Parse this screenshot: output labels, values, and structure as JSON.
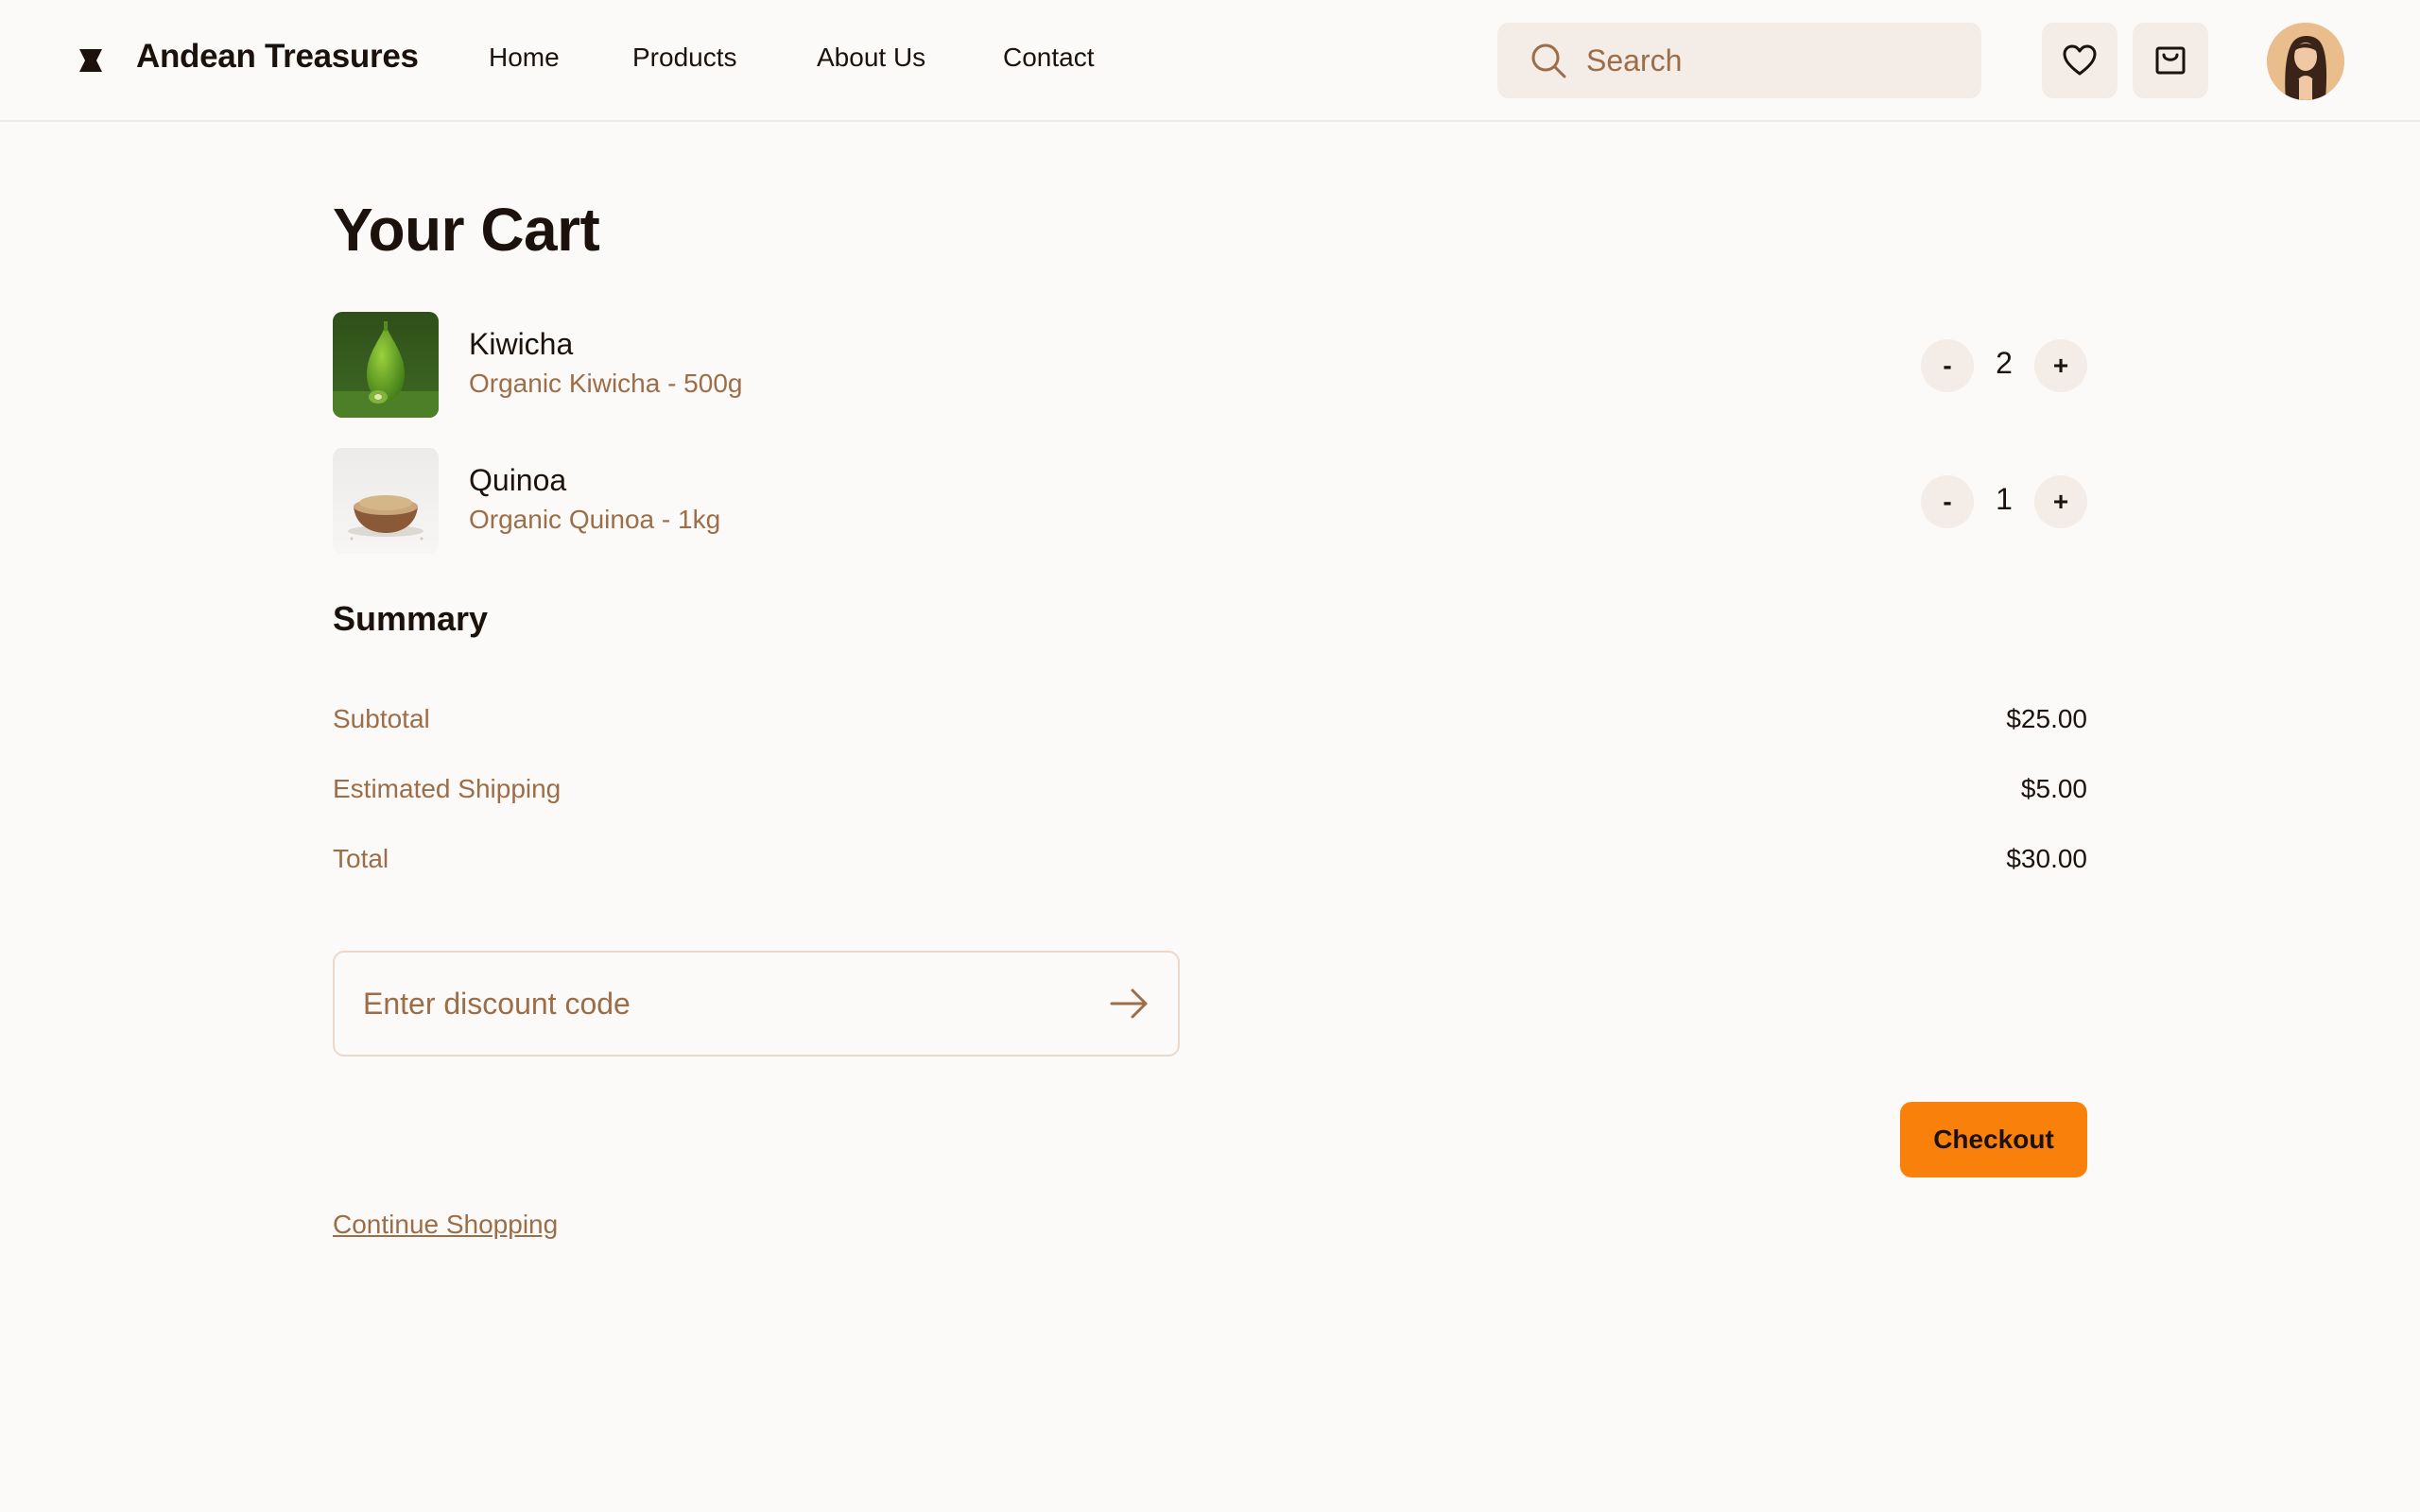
{
  "header": {
    "brand": "Andean Treasures",
    "nav": [
      "Home",
      "Products",
      "About Us",
      "Contact"
    ],
    "search_placeholder": "Search",
    "icons": [
      "logo-icon",
      "search-icon",
      "heart-icon",
      "cart-icon",
      "avatar"
    ]
  },
  "main": {
    "title": "Your Cart",
    "items": [
      {
        "name": "Kiwicha",
        "description": "Organic Kiwicha - 500g",
        "quantity": "2",
        "minus": "-",
        "plus": "+"
      },
      {
        "name": "Quinoa",
        "description": "Organic Quinoa - 1kg",
        "quantity": "1",
        "minus": "-",
        "plus": "+"
      }
    ],
    "summary": {
      "title": "Summary",
      "rows": [
        {
          "label": "Subtotal",
          "value": "$25.00"
        },
        {
          "label": "Estimated Shipping",
          "value": "$5.00"
        },
        {
          "label": "Total",
          "value": "$30.00"
        }
      ]
    },
    "discount_placeholder": "Enter discount code",
    "checkout_label": "Checkout",
    "continue_label": "Continue Shopping"
  },
  "colors": {
    "background": "#fcfaf8",
    "text": "#1c120d",
    "muted": "#9c6d47",
    "chip": "#f4ece6",
    "accent": "#f9800b"
  }
}
